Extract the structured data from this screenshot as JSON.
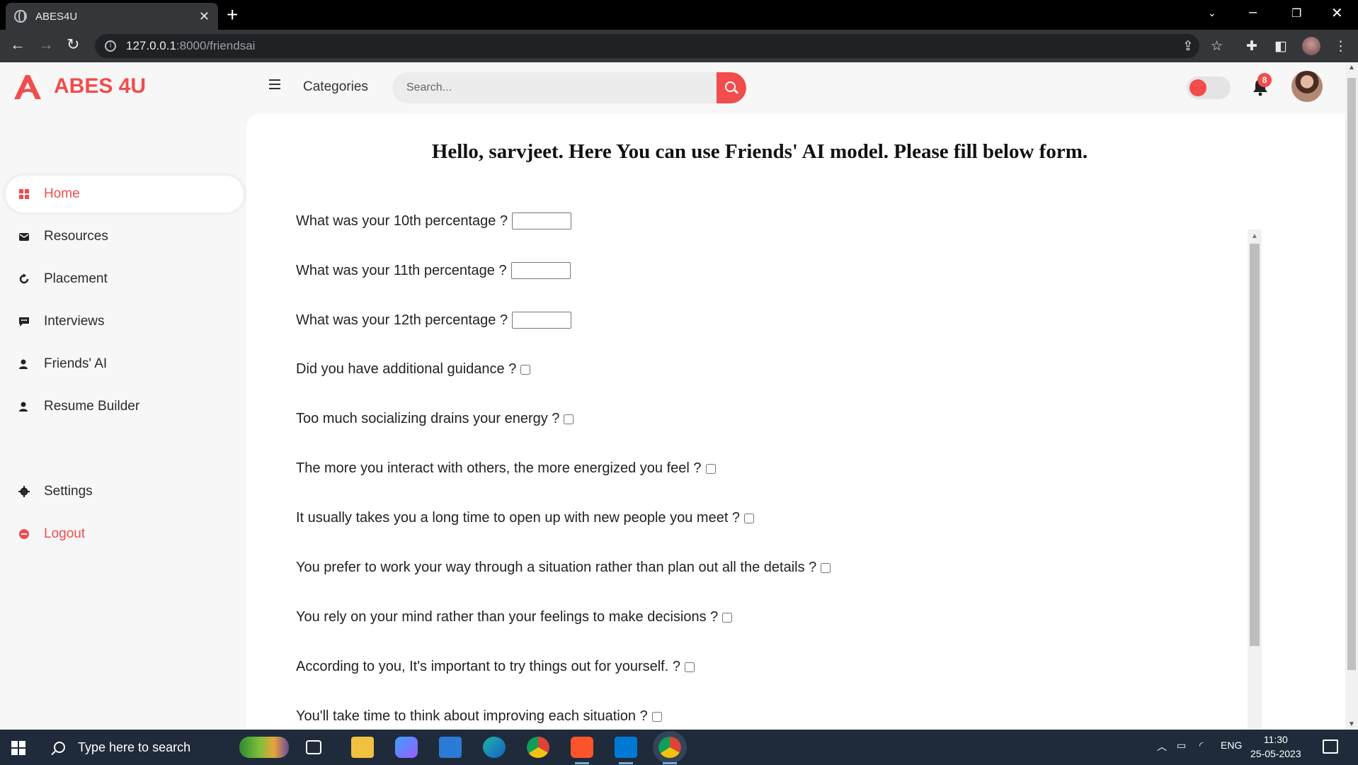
{
  "browser": {
    "tab_title": "ABES4U",
    "url_host": "127.0.0.1",
    "url_path": ":8000/friendsai"
  },
  "brand": {
    "name": "ABES 4U",
    "accent_color": "#f24c4c"
  },
  "header": {
    "categories_label": "Categories",
    "search_placeholder": "Search...",
    "notification_count": "8"
  },
  "sidebar": {
    "items": [
      {
        "label": "Home",
        "icon": "grid-icon",
        "active": true
      },
      {
        "label": "Resources",
        "icon": "mail-icon"
      },
      {
        "label": "Placement",
        "icon": "refresh-icon"
      },
      {
        "label": "Interviews",
        "icon": "chat-icon"
      },
      {
        "label": "Friends' AI",
        "icon": "users-icon"
      },
      {
        "label": "Resume Builder",
        "icon": "users-icon"
      }
    ],
    "settings_label": "Settings",
    "logout_label": "Logout"
  },
  "main": {
    "heading": "Hello, sarvjeet. Here You can use Friends' AI model. Please fill below form.",
    "questions": [
      {
        "label": "What was your 10th percentage ?",
        "type": "text"
      },
      {
        "label": "What was your 11th percentage ?",
        "type": "text"
      },
      {
        "label": "What was your 12th percentage ?",
        "type": "text"
      },
      {
        "label": "Did you have additional guidance ?",
        "type": "checkbox"
      },
      {
        "label": "Too much socializing drains your energy ?",
        "type": "checkbox"
      },
      {
        "label": "The more you interact with others, the more energized you feel ?",
        "type": "checkbox"
      },
      {
        "label": "It usually takes you a long time to open up with new people you meet ?",
        "type": "checkbox"
      },
      {
        "label": "You prefer to work your way through a situation rather than plan out all the details ?",
        "type": "checkbox"
      },
      {
        "label": "You rely on your mind rather than your feelings to make decisions ?",
        "type": "checkbox"
      },
      {
        "label": "According to you, It's important to try things out for yourself. ?",
        "type": "checkbox"
      },
      {
        "label": "You'll take time to think about improving each situation ?",
        "type": "checkbox"
      }
    ]
  },
  "taskbar": {
    "search_placeholder": "Type here to search",
    "language": "ENG",
    "time": "11:30",
    "date": "25-05-2023"
  }
}
